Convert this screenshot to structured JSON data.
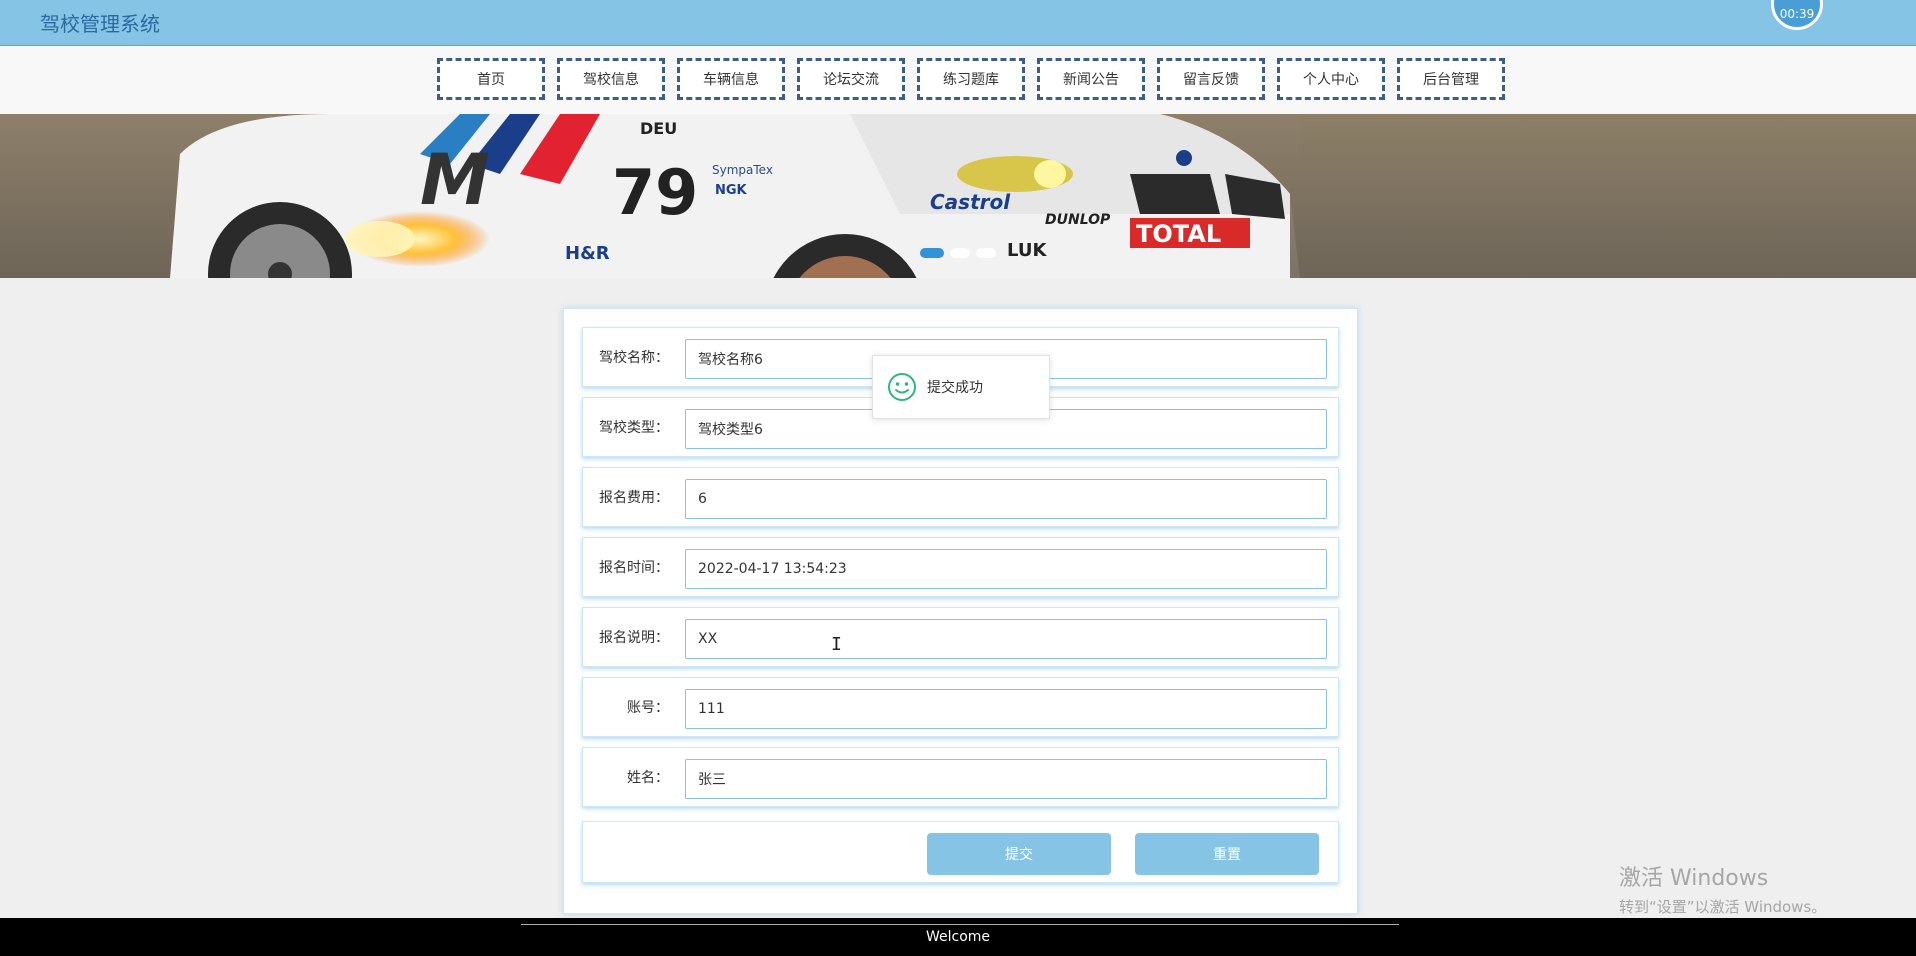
{
  "header": {
    "title": "驾校管理系统",
    "timer": "00:39"
  },
  "nav": {
    "items": [
      {
        "label": "首页"
      },
      {
        "label": "驾校信息"
      },
      {
        "label": "车辆信息"
      },
      {
        "label": "论坛交流"
      },
      {
        "label": "练习题库"
      },
      {
        "label": "新闻公告"
      },
      {
        "label": "留言反馈"
      },
      {
        "label": "个人中心"
      },
      {
        "label": "后台管理"
      }
    ]
  },
  "banner": {
    "car_texts": [
      "DEU",
      "79",
      "Castrol",
      "DUNLOP",
      "TOTAL",
      "LUK",
      "H&R",
      "SympaTex",
      "NGK"
    ]
  },
  "form": {
    "fields": [
      {
        "label": "驾校名称：",
        "value": "驾校名称6"
      },
      {
        "label": "驾校类型：",
        "value": "驾校类型6"
      },
      {
        "label": "报名费用：",
        "value": "6"
      },
      {
        "label": "报名时间：",
        "value": "2022-04-17 13:54:23"
      },
      {
        "label": "报名说明：",
        "value": "XX"
      },
      {
        "label": "账号：",
        "value": "111"
      },
      {
        "label": "姓名：",
        "value": "张三"
      }
    ],
    "submit_label": "提交",
    "reset_label": "重置"
  },
  "toast": {
    "text": "提交成功"
  },
  "watermark": {
    "title": "激活 Windows",
    "subtitle": "转到“设置”以激活 Windows。"
  },
  "footer": {
    "text": "Welcome"
  },
  "colors": {
    "accent": "#86c4e6",
    "nav_border": "#3c5e8a",
    "toast_icon": "#2fb87d"
  }
}
